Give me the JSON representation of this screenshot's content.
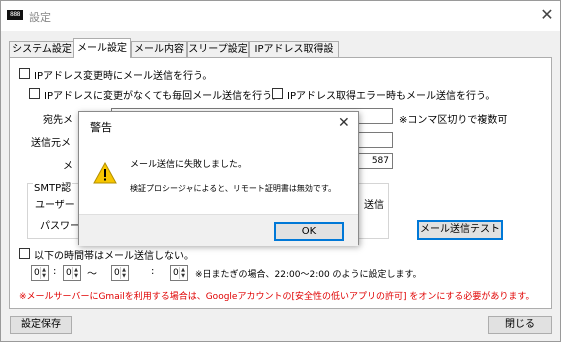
{
  "window": {
    "app_icon_text": "888",
    "title": "設定"
  },
  "tabs": [
    {
      "label": "システム設定"
    },
    {
      "label": "メール設定"
    },
    {
      "label": "メール内容"
    },
    {
      "label": "スリープ設定"
    },
    {
      "label": "IPアドレス取得設定"
    }
  ],
  "mail": {
    "send_on_ip_change": "IPアドレス変更時にメール送信を行う。",
    "send_every_time": "IPアドレスに変更がなくても毎回メール送信を行う。",
    "send_on_error": "IPアドレス取得エラー時もメール送信を行う。",
    "to_label": "宛先メ",
    "to_note": "※コンマ区切りで複数可",
    "from_label": "送信元メ",
    "port_label": "メ",
    "port_value": "587",
    "smtp_label": "SMTP認",
    "user_label": "ユーザー",
    "password_label": "パスワー",
    "send_partial": "送信",
    "test_button": "メール送信テスト",
    "no_send_hours": "以下の時間帯はメール送信しない。",
    "time_from_hour": "0",
    "time_from_min": "0",
    "time_to_hour": "0",
    "time_to_min": "0",
    "colon": ":",
    "tilde": "〜",
    "cross_day_note": "※日またぎの場合、22:00〜2:00 のように設定します。",
    "gmail_warning": "※メールサーバーにGmailを利用する場合は、Googleアカウントの[安全性の低いアプリの許可] をオンにする必要があります。"
  },
  "footer": {
    "save_button": "設定保存",
    "close_button": "閉じる"
  },
  "dialog": {
    "title": "警告",
    "message": "メール送信に失敗しました。",
    "detail": "検証プロシージャによると、リモート証明書は無効です。",
    "ok_button": "OK"
  }
}
